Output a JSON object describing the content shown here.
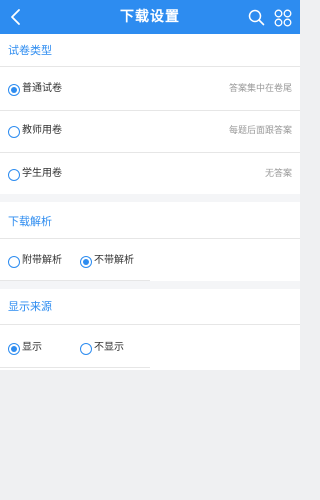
{
  "header": {
    "title": "下载设置"
  },
  "paper_type": {
    "title": "试卷类型",
    "options": [
      {
        "label": "普通试卷",
        "desc": "答案集中在卷尾",
        "checked": true
      },
      {
        "label": "教师用卷",
        "desc": "每题后面跟答案",
        "checked": false
      },
      {
        "label": "学生用卷",
        "desc": "无答案",
        "checked": false
      }
    ]
  },
  "analysis": {
    "title": "下载解析",
    "options": [
      {
        "label": "附带解析",
        "checked": false
      },
      {
        "label": "不带解析",
        "checked": true
      }
    ]
  },
  "source": {
    "title": "显示来源",
    "options": [
      {
        "label": "显示",
        "checked": true
      },
      {
        "label": "不显示",
        "checked": false
      }
    ]
  },
  "colors": {
    "accent": "#2d8cf0",
    "background": "#eff0f2"
  }
}
